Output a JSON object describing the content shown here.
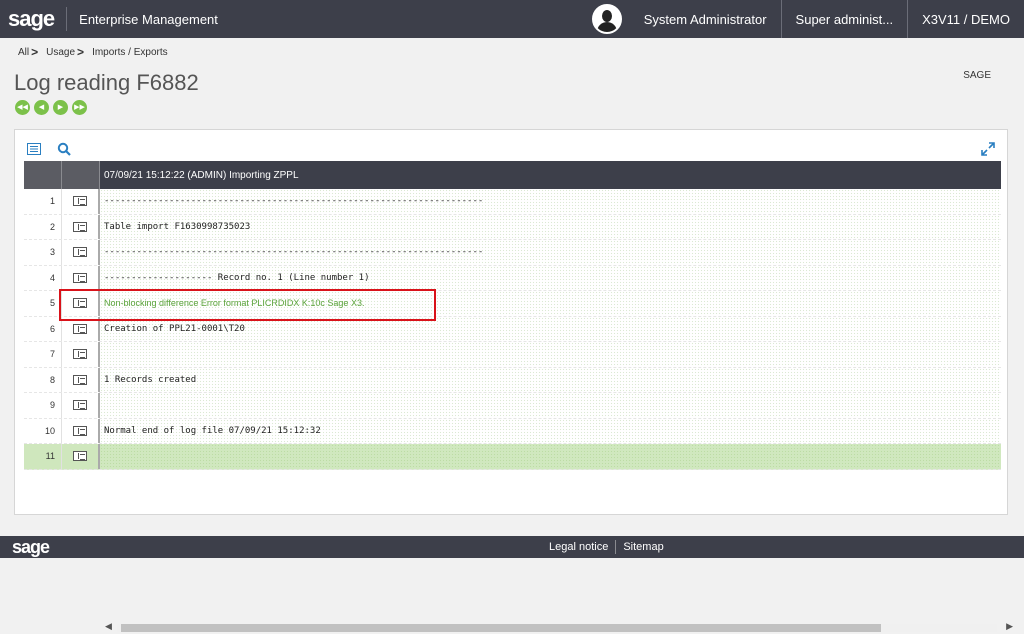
{
  "topbar": {
    "logo": "sage",
    "app_title": "Enterprise Management",
    "user": "System Administrator",
    "role": "Super administ...",
    "folder": "X3V11 / DEMO"
  },
  "breadcrumb": [
    {
      "label": "All"
    },
    {
      "label": "Usage"
    },
    {
      "label": "Imports / Exports"
    }
  ],
  "page": {
    "title": "Log reading F6882",
    "company": "SAGE"
  },
  "grid": {
    "header": "07/09/21 15:12:22 (ADMIN) Importing ZPPL",
    "rows": [
      {
        "num": "1",
        "text": "----------------------------------------------------------------------"
      },
      {
        "num": "2",
        "text": "Table import F1630998735023"
      },
      {
        "num": "3",
        "text": "----------------------------------------------------------------------"
      },
      {
        "num": "4",
        "text": "-------------------- Record no. 1 (Line number 1)"
      },
      {
        "num": "5",
        "text": "Non-blocking difference Error format PLICRDIDX K:10c Sage X3."
      },
      {
        "num": "6",
        "text": "Creation of PPL21-0001\\T20"
      },
      {
        "num": "7",
        "text": ""
      },
      {
        "num": "8",
        "text": "1 Records created"
      },
      {
        "num": "9",
        "text": ""
      },
      {
        "num": "10",
        "text": "Normal end of log file 07/09/21 15:12:32"
      },
      {
        "num": "11",
        "text": ""
      }
    ],
    "selected_row": "11",
    "highlight_row": "5",
    "colors": {
      "highlight_border": "#d9121a",
      "accent": "#7cc14a",
      "warning_text": "#5aa33a"
    }
  },
  "footer": {
    "logo": "sage",
    "legal": "Legal notice",
    "sitemap": "Sitemap"
  }
}
